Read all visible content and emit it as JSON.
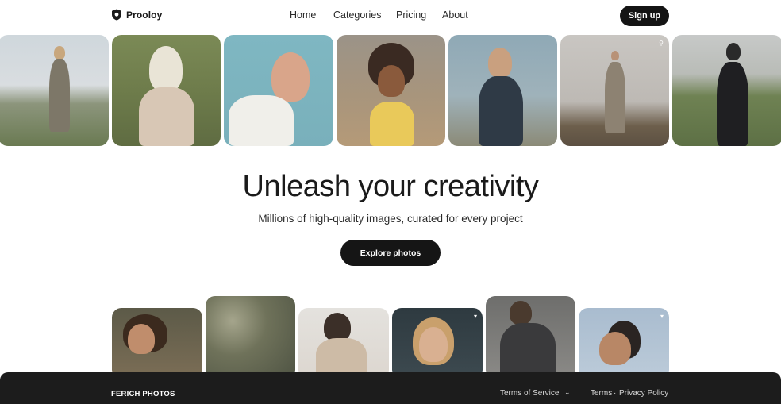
{
  "brand": {
    "name": "Prooloy",
    "icon": "shield-logo-icon"
  },
  "nav": {
    "items": [
      {
        "label": "Home"
      },
      {
        "label": "Categories"
      },
      {
        "label": "Pricing"
      },
      {
        "label": "About"
      }
    ],
    "signup_label": "Sign up"
  },
  "hero": {
    "title": "Unleash your creativity",
    "subtitle": "Millions of high-quality images, curated for every project",
    "cta_label": "Explore photos"
  },
  "footer": {
    "brand": "FERICH PHOTOS",
    "terms_of_service": "Terms of Service",
    "terms": "Terms",
    "separator": "·",
    "privacy": "Privacy Policy"
  },
  "colors": {
    "primary_button": "#141414",
    "footer_bg": "#1c1c1c",
    "text": "#1a1a1a"
  }
}
